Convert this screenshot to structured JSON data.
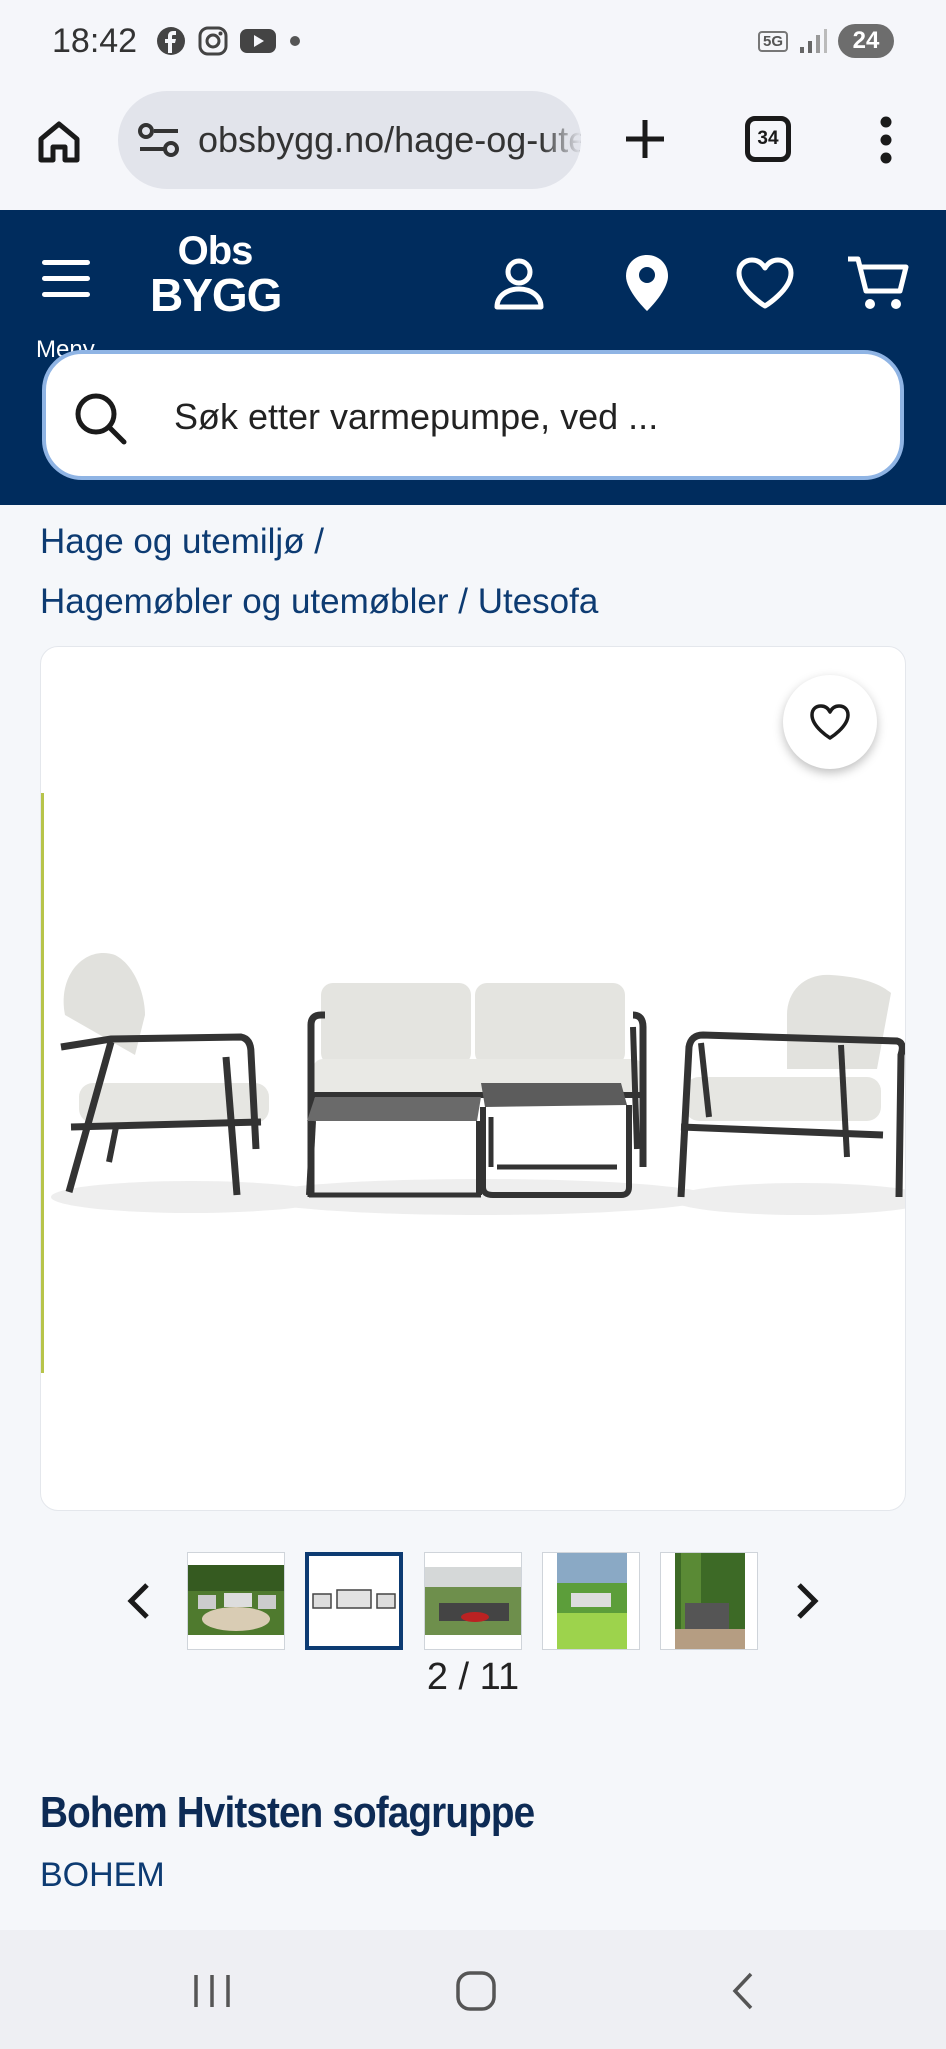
{
  "status_bar": {
    "time": "18:42",
    "notification_icons": [
      "facebook-icon",
      "instagram-icon",
      "youtube-icon",
      "dot-icon"
    ],
    "network": "5G",
    "battery": "24"
  },
  "browser": {
    "url": "obsbygg.no/hage-og-utemiljo",
    "tab_count": "34"
  },
  "header": {
    "menu_label": "Meny",
    "logo_line1": "Obs",
    "logo_line2": "BYGG",
    "search_placeholder": "Søk etter varmepumpe, ved ..."
  },
  "breadcrumb": {
    "items": [
      "Hage og utemiljø",
      "Hagemøbler og utemøbler",
      "Utesofa"
    ],
    "separator": " / "
  },
  "gallery": {
    "current": 2,
    "total": 11,
    "counter_text": "2 / 11",
    "thumbnails": [
      "garden-scene",
      "white-studio",
      "pergola-scene",
      "green-lawn",
      "tall-plants"
    ],
    "active_index": 1
  },
  "product": {
    "title": "Bohem Hvitsten sofagruppe",
    "brand": "BOHEM"
  },
  "colors": {
    "brand_navy": "#002c5d",
    "link_blue": "#0d3b72",
    "search_border": "#8fb4e4"
  }
}
